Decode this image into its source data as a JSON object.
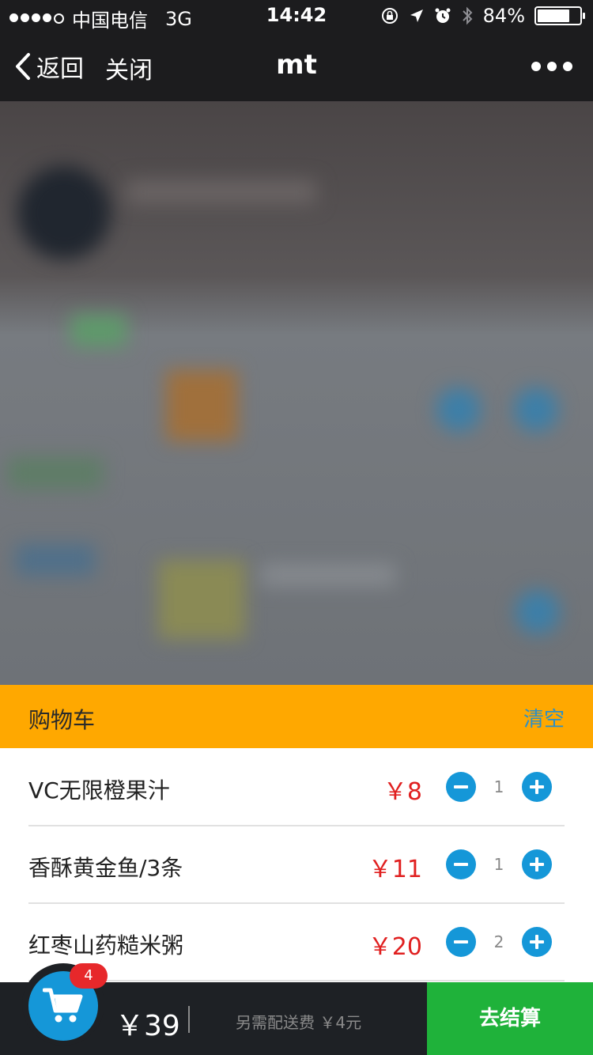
{
  "status_bar": {
    "carrier": "中国电信",
    "network": "3G",
    "time": "14:42",
    "battery": "84%",
    "battery_level": 0.84
  },
  "nav": {
    "back_label": "返回",
    "close_label": "关闭",
    "title": "mt"
  },
  "cart": {
    "title": "购物车",
    "clear_label": "清空",
    "items": [
      {
        "name": "VC无限橙果汁",
        "price": "￥8",
        "qty": "1"
      },
      {
        "name": "香酥黄金鱼/3条",
        "price": "￥11",
        "qty": "1"
      },
      {
        "name": "红枣山药糙米粥",
        "price": "￥20",
        "qty": "2"
      }
    ]
  },
  "bottom": {
    "badge_count": "4",
    "total": "￥39",
    "delivery_note": "另需配送费 ￥4元",
    "checkout_label": "去结算"
  },
  "colors": {
    "accent": "#ffa800",
    "button_blue": "#1597d8",
    "price_red": "#e02020",
    "checkout_green": "#1fb23a"
  }
}
